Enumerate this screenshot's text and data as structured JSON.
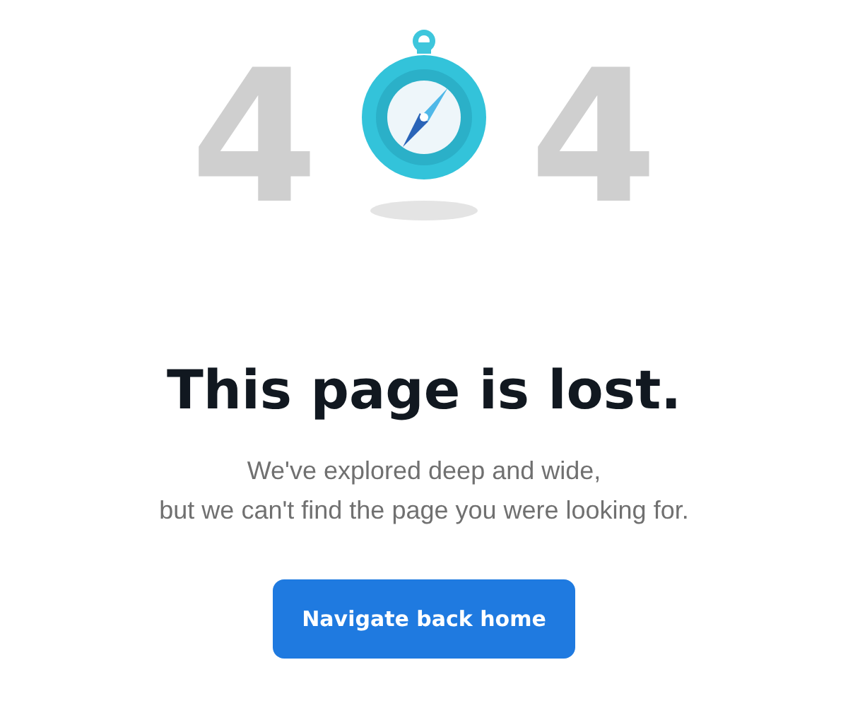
{
  "hero": {
    "digits": [
      "4",
      "4"
    ]
  },
  "title": "This page is lost.",
  "message": [
    "We've explored deep and wide,",
    "but we can't find the page you were looking for."
  ],
  "button": {
    "label": "Navigate back home"
  }
}
